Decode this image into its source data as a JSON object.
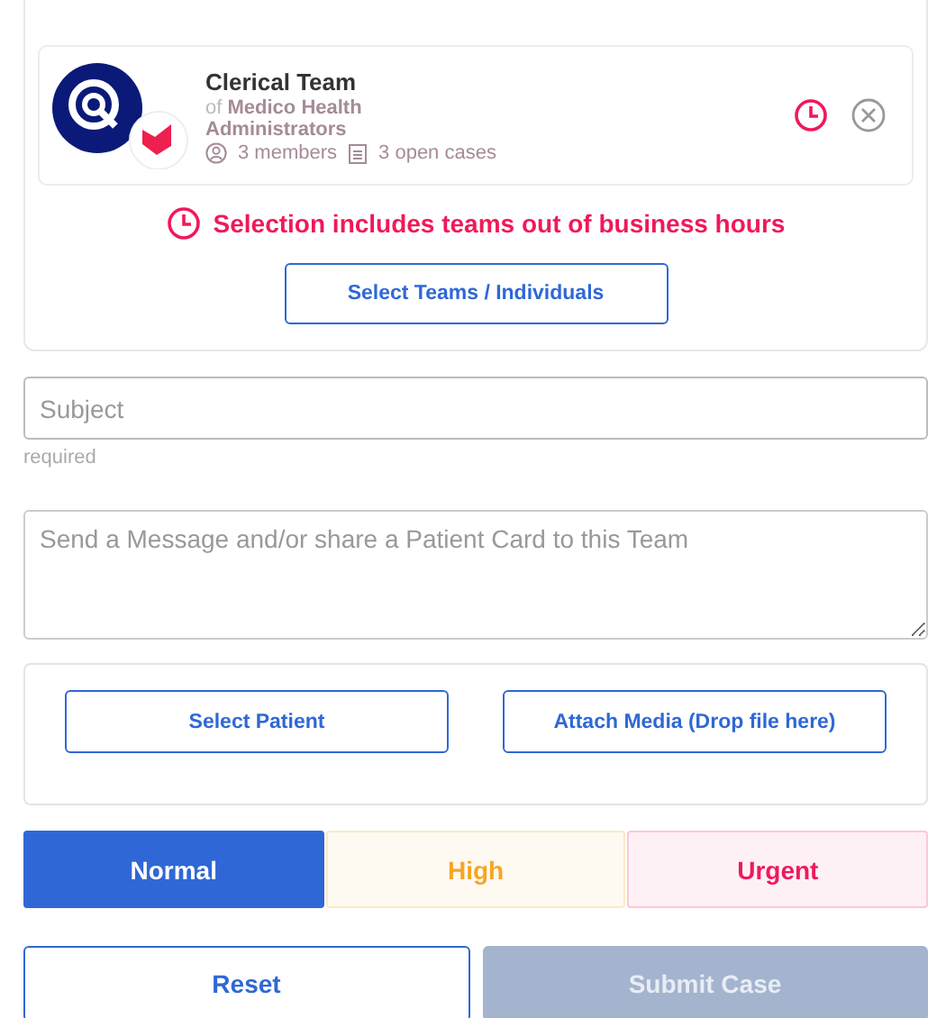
{
  "team_card": {
    "name": "Clerical Team",
    "of_label": "of",
    "organization": "Medico Health Administrators",
    "members": "3 members",
    "open_cases": "3 open cases",
    "out_of_hours": true
  },
  "warning": "Selection includes teams out of business hours",
  "select_button": "Select Teams / Individuals",
  "subject": {
    "placeholder": "Subject",
    "hint": "required"
  },
  "message": {
    "placeholder": "Send a Message and/or share a Patient Card to this Team"
  },
  "attach_buttons": [
    "Select Patient",
    "Attach Media (Drop file here)"
  ],
  "priorities": [
    {
      "label": "Normal",
      "selected": true,
      "color": "#2f68d6"
    },
    {
      "label": "High",
      "selected": false,
      "color": "#f5a623"
    },
    {
      "label": "Urgent",
      "selected": false,
      "color": "#f0195a"
    }
  ],
  "actions": [
    {
      "label": "Reset",
      "kind": "outline",
      "disabled": false
    },
    {
      "label": "Submit Case",
      "kind": "primary",
      "disabled": true
    }
  ]
}
